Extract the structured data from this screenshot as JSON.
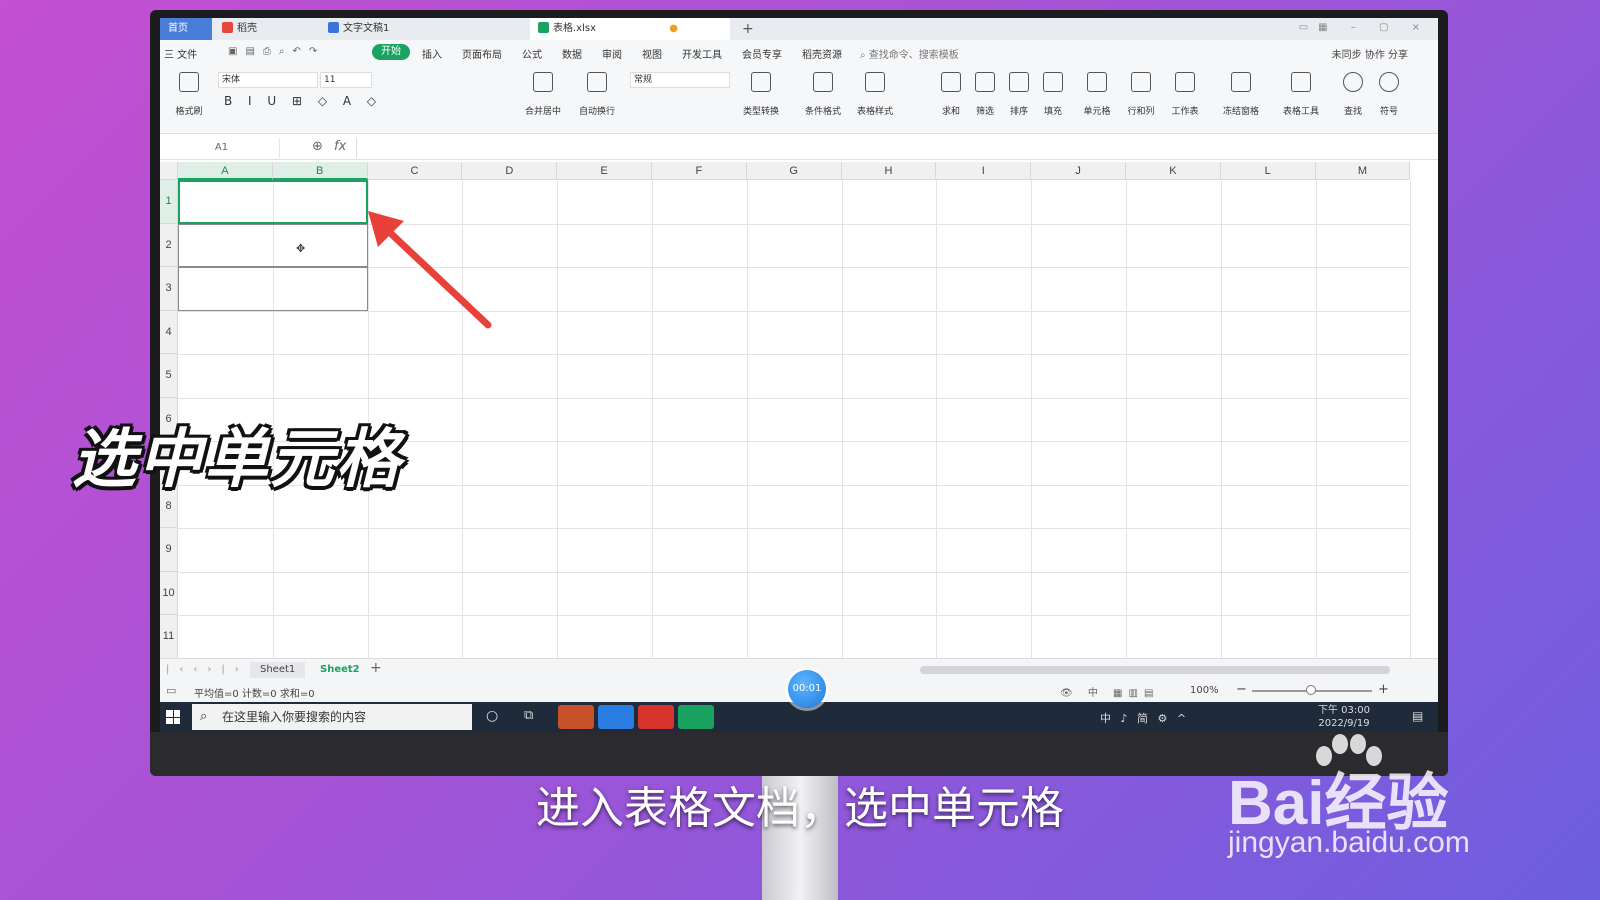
{
  "window": {
    "tabs": [
      {
        "label": "首页"
      },
      {
        "label": "稻壳"
      },
      {
        "label": "文字文稿1"
      },
      {
        "label": "表格.xlsx"
      }
    ]
  },
  "menu": {
    "file": "三 文件",
    "start": "开始",
    "items": [
      "插入",
      "页面布局",
      "公式",
      "数据",
      "审阅",
      "视图",
      "开发工具",
      "会员专享",
      "稻壳资源"
    ],
    "search": "查找命令、搜索模板",
    "right": "未同步   协作   分享"
  },
  "ribbon": {
    "font_name": "宋体",
    "font_size": "11",
    "number_format": "常规",
    "bold_row": "B I U ⊞ ◇ A ◇",
    "buttons": [
      "格式刷",
      "合并居中",
      "自动换行",
      "类型转换",
      "条件格式",
      "表格样式",
      "求和",
      "筛选",
      "排序",
      "填充",
      "单元格",
      "行和列",
      "工作表",
      "冻结窗格",
      "表格工具",
      "查找",
      "符号"
    ]
  },
  "formula_bar": {
    "name_box": "A1",
    "fx": "fx"
  },
  "grid": {
    "columns": [
      "A",
      "B",
      "C",
      "D",
      "E",
      "F",
      "G",
      "H",
      "I",
      "J",
      "K",
      "L",
      "M"
    ],
    "rows": [
      "1",
      "2",
      "3",
      "4",
      "5",
      "6",
      "7",
      "8",
      "9",
      "10",
      "11"
    ],
    "active_cell": "A1"
  },
  "sheets": {
    "tabs": [
      "Sheet1",
      "Sheet2"
    ],
    "active": "Sheet2",
    "add": "+"
  },
  "status": {
    "stats": "平均值=0  计数=0  求和=0",
    "zoom": "100%"
  },
  "taskbar": {
    "search_placeholder": "在这里输入你要搜索的内容",
    "tray": "中 ♪ 简 ⚙ ^",
    "time": "下午 03:00",
    "date": "2022/9/19"
  },
  "overlay": {
    "caption": "选中单元格",
    "subtitle": "进入表格文档，选中单元格",
    "timer": "00:01",
    "watermark_brand": "Bai经验",
    "watermark_url": "jingyan.baidu.com"
  },
  "colors": {
    "accent": "#1aa260",
    "arrow": "#e8413a",
    "tab_home": "#4a7dd8"
  }
}
